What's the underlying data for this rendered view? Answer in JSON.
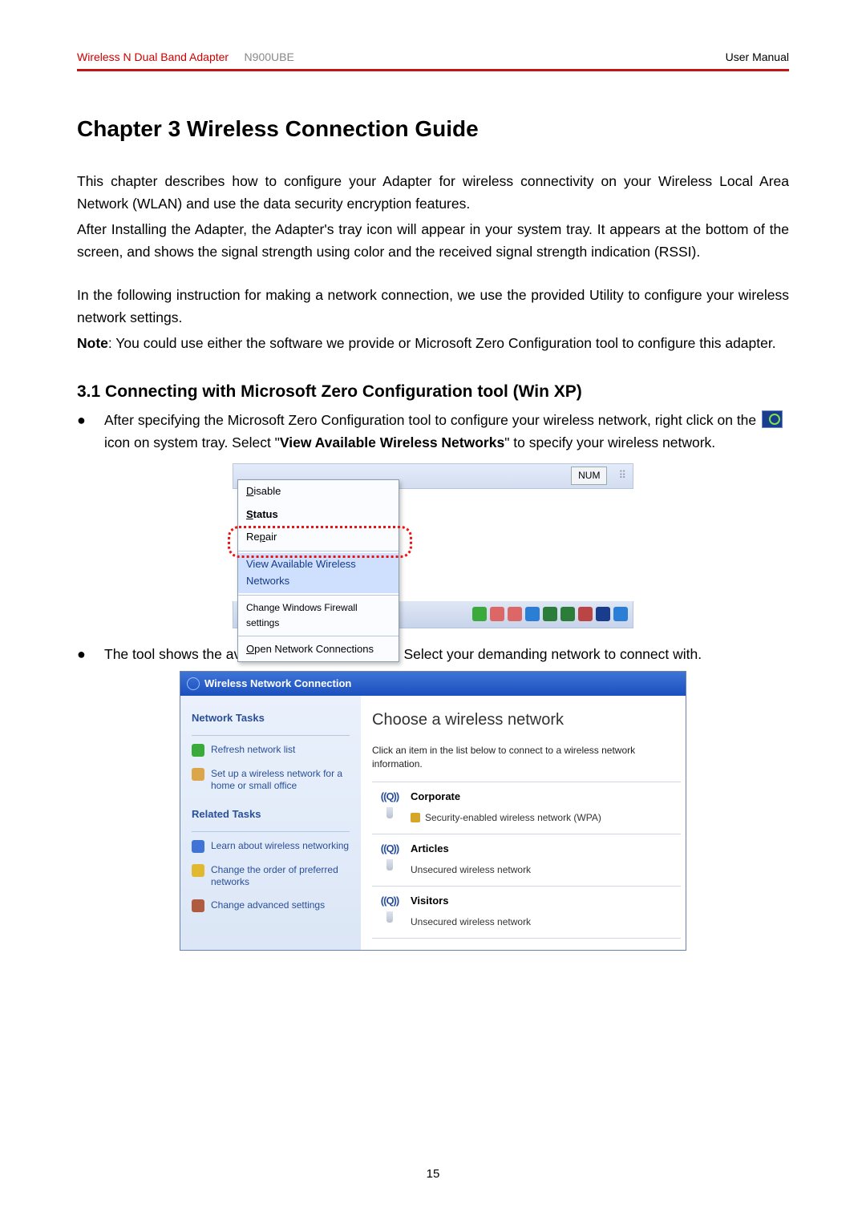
{
  "header": {
    "product": "Wireless N Dual Band Adapter",
    "model": "N900UBE",
    "doc": "User Manual"
  },
  "title": "Chapter 3 Wireless Connection Guide",
  "para1": "This chapter describes how to configure your Adapter for wireless connectivity on your Wireless Local Area Network (WLAN) and use the data security encryption features.",
  "para2": "After Installing the Adapter, the Adapter's tray icon will appear in your system tray. It appears at the bottom of the screen, and shows the signal strength using color and the received signal strength indication (RSSI).",
  "para3": "In the following instruction for making a network connection, we use the provided Utility to configure your wireless network settings.",
  "note_label": "Note",
  "note_text": ": You could use either the software we provide or Microsoft Zero Configuration tool to configure this adapter.",
  "section_title": "3.1 Connecting with Microsoft Zero Configuration tool (Win XP)",
  "bullet1_a": "After specifying the Microsoft Zero Configuration tool to configure your wireless network, right click on the ",
  "bullet1_b": " icon on system tray. Select \"",
  "bullet1_bold": "View Available Wireless Networks",
  "bullet1_c": "\" to specify your wireless network.",
  "bullet2": "The tool shows the available wireless networks. Select your demanding network to connect with.",
  "tray": {
    "num": "NUM",
    "items": {
      "disable": "Disable",
      "status": "Status",
      "repair": "Repair",
      "view": "View Available Wireless Networks",
      "fw": "Change Windows Firewall settings",
      "open": "Open Network Connections"
    }
  },
  "xp": {
    "title": "Wireless Network Connection",
    "side": {
      "tasks": "Network Tasks",
      "refresh": "Refresh network list",
      "setup": "Set up a wireless network for a home or small office",
      "related": "Related Tasks",
      "learn": "Learn about wireless networking",
      "order": "Change the order of preferred networks",
      "adv": "Change advanced settings"
    },
    "main": {
      "heading": "Choose a wireless network",
      "sub": "Click an item in the list below to connect to a wireless network information.",
      "nets": [
        {
          "name": "Corporate",
          "desc": "Security-enabled wireless network (WPA)",
          "locked": true
        },
        {
          "name": "Articles",
          "desc": "Unsecured wireless network",
          "locked": false
        },
        {
          "name": "Visitors",
          "desc": "Unsecured wireless network",
          "locked": false
        }
      ]
    }
  },
  "page_number": "15"
}
